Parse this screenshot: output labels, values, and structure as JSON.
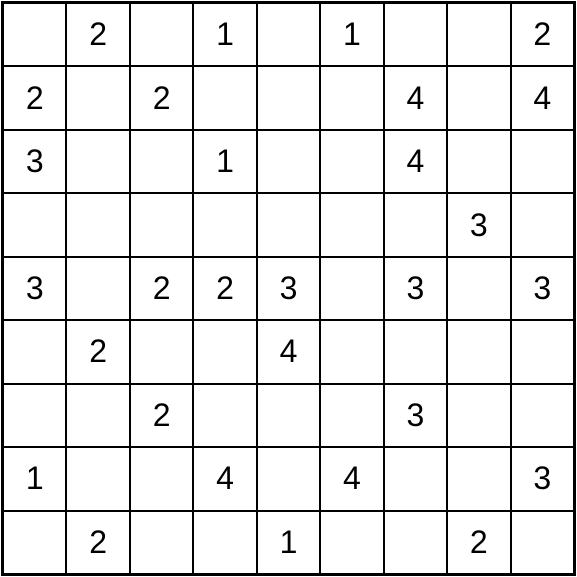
{
  "puzzle": {
    "type": "number-grid",
    "size": 9,
    "grid": [
      [
        "",
        "2",
        "",
        "1",
        "",
        "1",
        "",
        "",
        "2"
      ],
      [
        "2",
        "",
        "2",
        "",
        "",
        "",
        "4",
        "",
        "4"
      ],
      [
        "3",
        "",
        "",
        "1",
        "",
        "",
        "4",
        "",
        ""
      ],
      [
        "",
        "",
        "",
        "",
        "",
        "",
        "",
        "3",
        ""
      ],
      [
        "3",
        "",
        "2",
        "2",
        "3",
        "",
        "3",
        "",
        "3"
      ],
      [
        "",
        "2",
        "",
        "",
        "4",
        "",
        "",
        "",
        ""
      ],
      [
        "",
        "",
        "2",
        "",
        "",
        "",
        "3",
        "",
        ""
      ],
      [
        "1",
        "",
        "",
        "4",
        "",
        "4",
        "",
        "",
        "3"
      ],
      [
        "",
        "2",
        "",
        "",
        "1",
        "",
        "",
        "2",
        ""
      ]
    ]
  }
}
